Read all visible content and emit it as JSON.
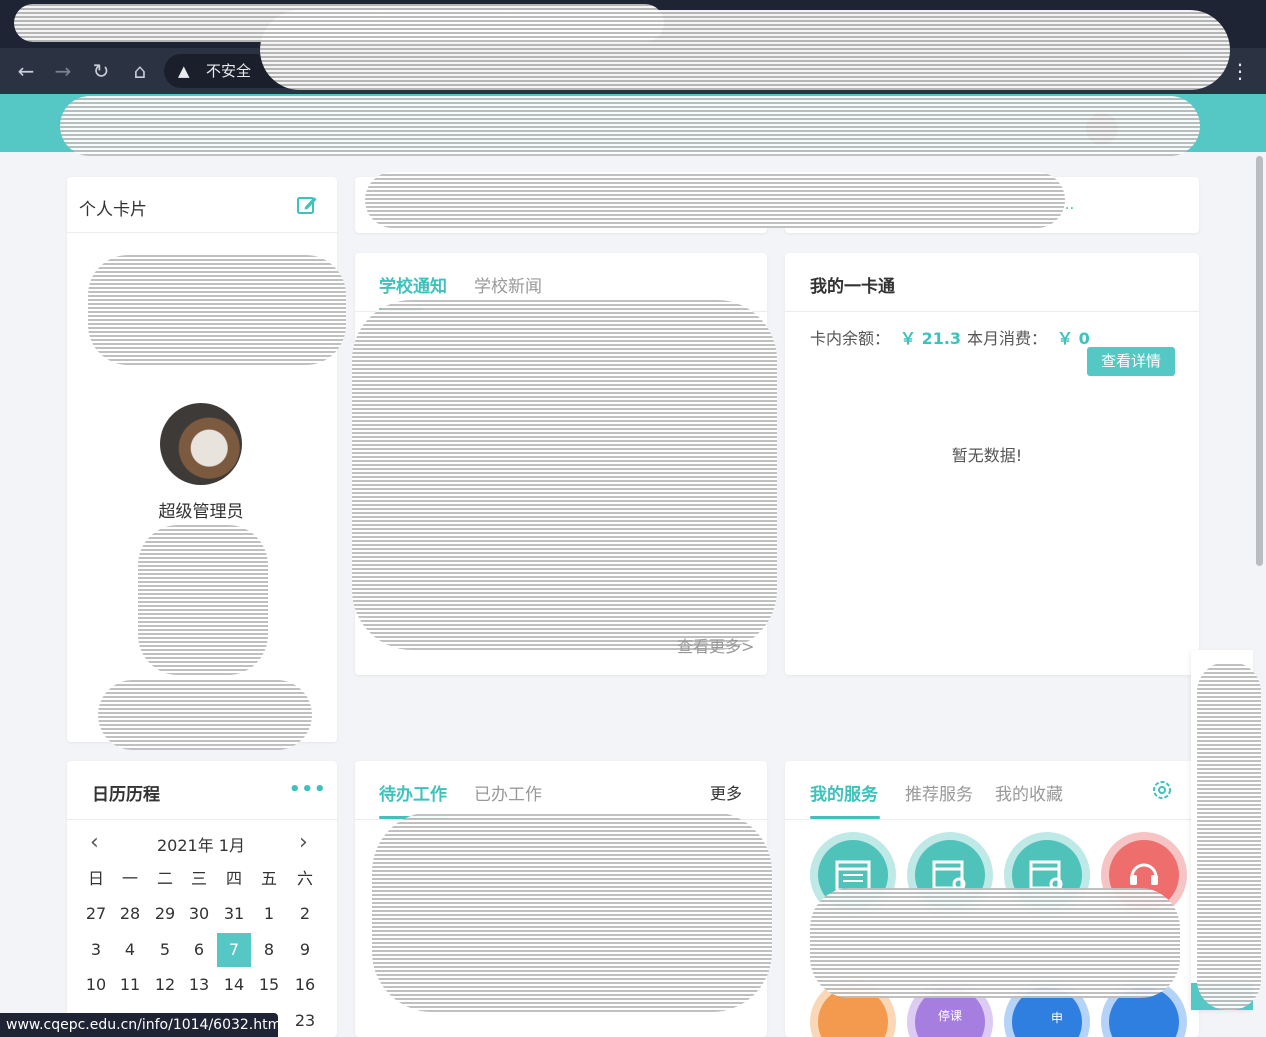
{
  "browser": {
    "security_icon": "warning-triangle-icon",
    "security_label": "不安全",
    "status_url": "www.cqepc.edu.cn/info/1014/6032.htm"
  },
  "profile": {
    "title": "个人卡片",
    "name": "超级管理员"
  },
  "notice": {
    "tabs": [
      "学校通知",
      "学校新闻"
    ],
    "more": "查看更多>"
  },
  "topbar": {
    "ellipsis": "..."
  },
  "campus_card": {
    "title": "我的一卡通",
    "balance_label": "卡内余额：",
    "balance_value": "￥ 21.3",
    "month_label": "本月消费：",
    "month_value": "￥ 0",
    "detail_button": "查看详情",
    "empty": "暂无数据!"
  },
  "calendar": {
    "title": "日历历程",
    "more": "•••",
    "year_month": "2021年  1月",
    "weekdays": [
      "日",
      "一",
      "二",
      "三",
      "四",
      "五",
      "六"
    ],
    "rows": [
      [
        "27",
        "28",
        "29",
        "30",
        "31",
        "1",
        "2"
      ],
      [
        "3",
        "4",
        "5",
        "6",
        "7",
        "8",
        "9"
      ],
      [
        "10",
        "11",
        "12",
        "13",
        "14",
        "15",
        "16"
      ],
      [
        "",
        "",
        "",
        "",
        "",
        "",
        "23"
      ]
    ],
    "selected_day": "7"
  },
  "work": {
    "tabs": [
      "待办工作",
      "已办工作"
    ],
    "more": "更多"
  },
  "services": {
    "tabs": [
      "我的服务",
      "推荐服务",
      "我的收藏"
    ],
    "items_row1": [
      {
        "icon": "calendar-list-icon",
        "color": "#4fc3b9"
      },
      {
        "icon": "calendar-search-icon",
        "color": "#4fc3b9"
      },
      {
        "icon": "calendar-search-icon",
        "color": "#4fc3b9"
      },
      {
        "icon": "headset-icon",
        "color": "#ee6e6e"
      }
    ],
    "items_row2": [
      {
        "icon": "user-orange-icon",
        "color": "#f39a4e"
      },
      {
        "icon": "stamp-purple-icon",
        "color": "#a67ee0",
        "text": "停课"
      },
      {
        "icon": "user-card-icon",
        "color": "#2f7fe0",
        "text": "申"
      },
      {
        "icon": "clipboard-icon",
        "color": "#2f7fe0"
      }
    ]
  }
}
